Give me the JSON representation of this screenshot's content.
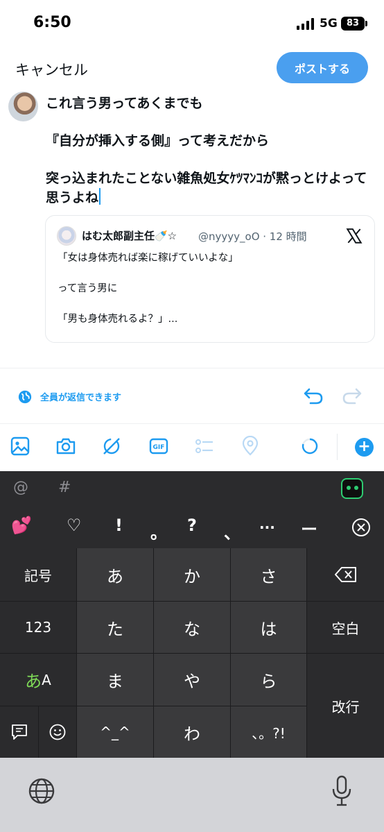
{
  "status_bar": {
    "time": "6:50",
    "network": "5G",
    "battery": "83"
  },
  "header": {
    "cancel": "キャンセル",
    "post": "ポストする"
  },
  "compose": {
    "paragraphs": [
      "これ言う男ってあくまでも",
      "『自分が挿入する側』って考えだから",
      "突っ込まれたことない雑魚処女ｹﾂﾏﾝｺが黙っとけよって思うよね"
    ]
  },
  "quote": {
    "name": "はむ太郎副主任🍼☆",
    "meta": "@nyyyy_oO · 12 時間",
    "lines": [
      "「女は身体売れば楽に稼げていいよな」",
      "って言う男に",
      "「男も身体売れるよ？」..."
    ]
  },
  "reply_setting": "全員が返信できます",
  "keyboard": {
    "symbols": [
      "@",
      "#"
    ],
    "candidates": [
      "💕",
      "♡",
      "!",
      "。",
      "?",
      "、",
      "...",
      "ー"
    ],
    "keys": {
      "kigou": "記号",
      "a": "あ",
      "ka": "か",
      "sa": "さ",
      "num": "123",
      "ta": "た",
      "na": "な",
      "ha": "は",
      "space": "空白",
      "kana_a": "あ",
      "kana_A": "A",
      "ma": "ま",
      "ya": "や",
      "ra": "ら",
      "enter": "改行",
      "kaomoji": "^_^",
      "wa": "わ",
      "punct": "、。?!"
    }
  },
  "colors": {
    "accent": "#1d9bf0",
    "post_button": "#4a9fef"
  }
}
